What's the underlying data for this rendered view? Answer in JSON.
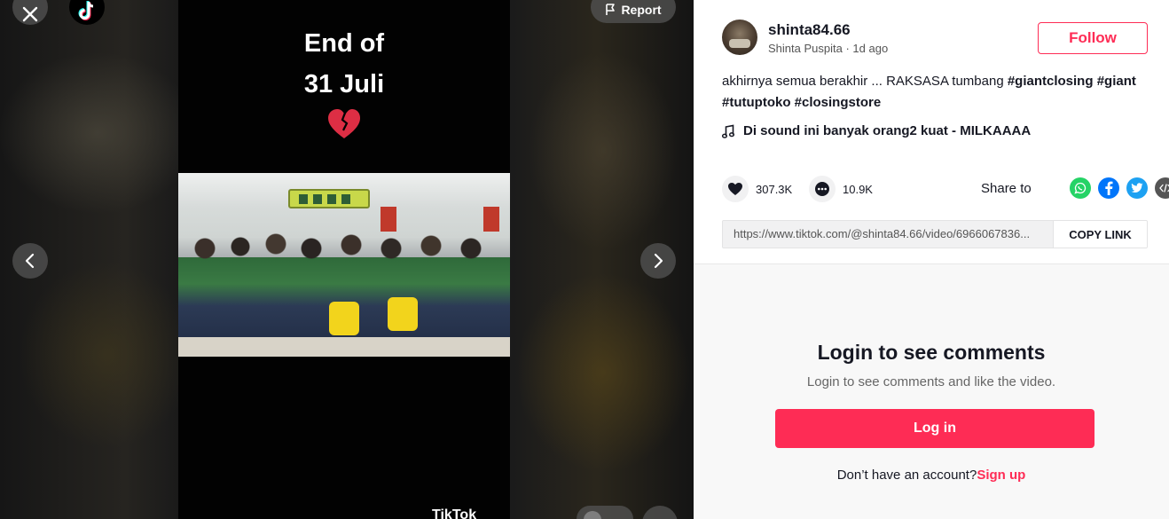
{
  "video": {
    "caption_line1": "End of",
    "caption_line2": "31 Juli",
    "emoji": "broken-heart",
    "watermark": "TikTok"
  },
  "controls": {
    "report_label": "Report"
  },
  "author": {
    "username": "shinta84.66",
    "nickname": "Shinta Puspita",
    "separator": " · ",
    "posted": "1d ago",
    "follow_label": "Follow"
  },
  "description": {
    "text": "akhirnya semua berakhir ... RAKSASA tumbang ",
    "hashtags": [
      "#giantclosing",
      "#giant",
      "#tutuptoko",
      "#closingstore"
    ]
  },
  "music": {
    "title": "Di sound ini banyak orang2 kuat - MILKAAAA"
  },
  "stats": {
    "likes": "307.3K",
    "comments": "10.9K"
  },
  "share": {
    "label": "Share to",
    "targets": [
      "whatsapp-icon",
      "facebook-icon",
      "twitter-icon",
      "embed-icon"
    ]
  },
  "link": {
    "url": "https://www.tiktok.com/@shinta84.66/video/6966067836...",
    "copy_label": "COPY LINK"
  },
  "comments": {
    "title": "Login to see comments",
    "subtitle": "Login to see comments and like the video.",
    "login_label": "Log in",
    "no_account": "Don’t have an account?",
    "signup_label": "Sign up"
  },
  "colors": {
    "accent": "#fe2c55",
    "text": "#161823"
  }
}
